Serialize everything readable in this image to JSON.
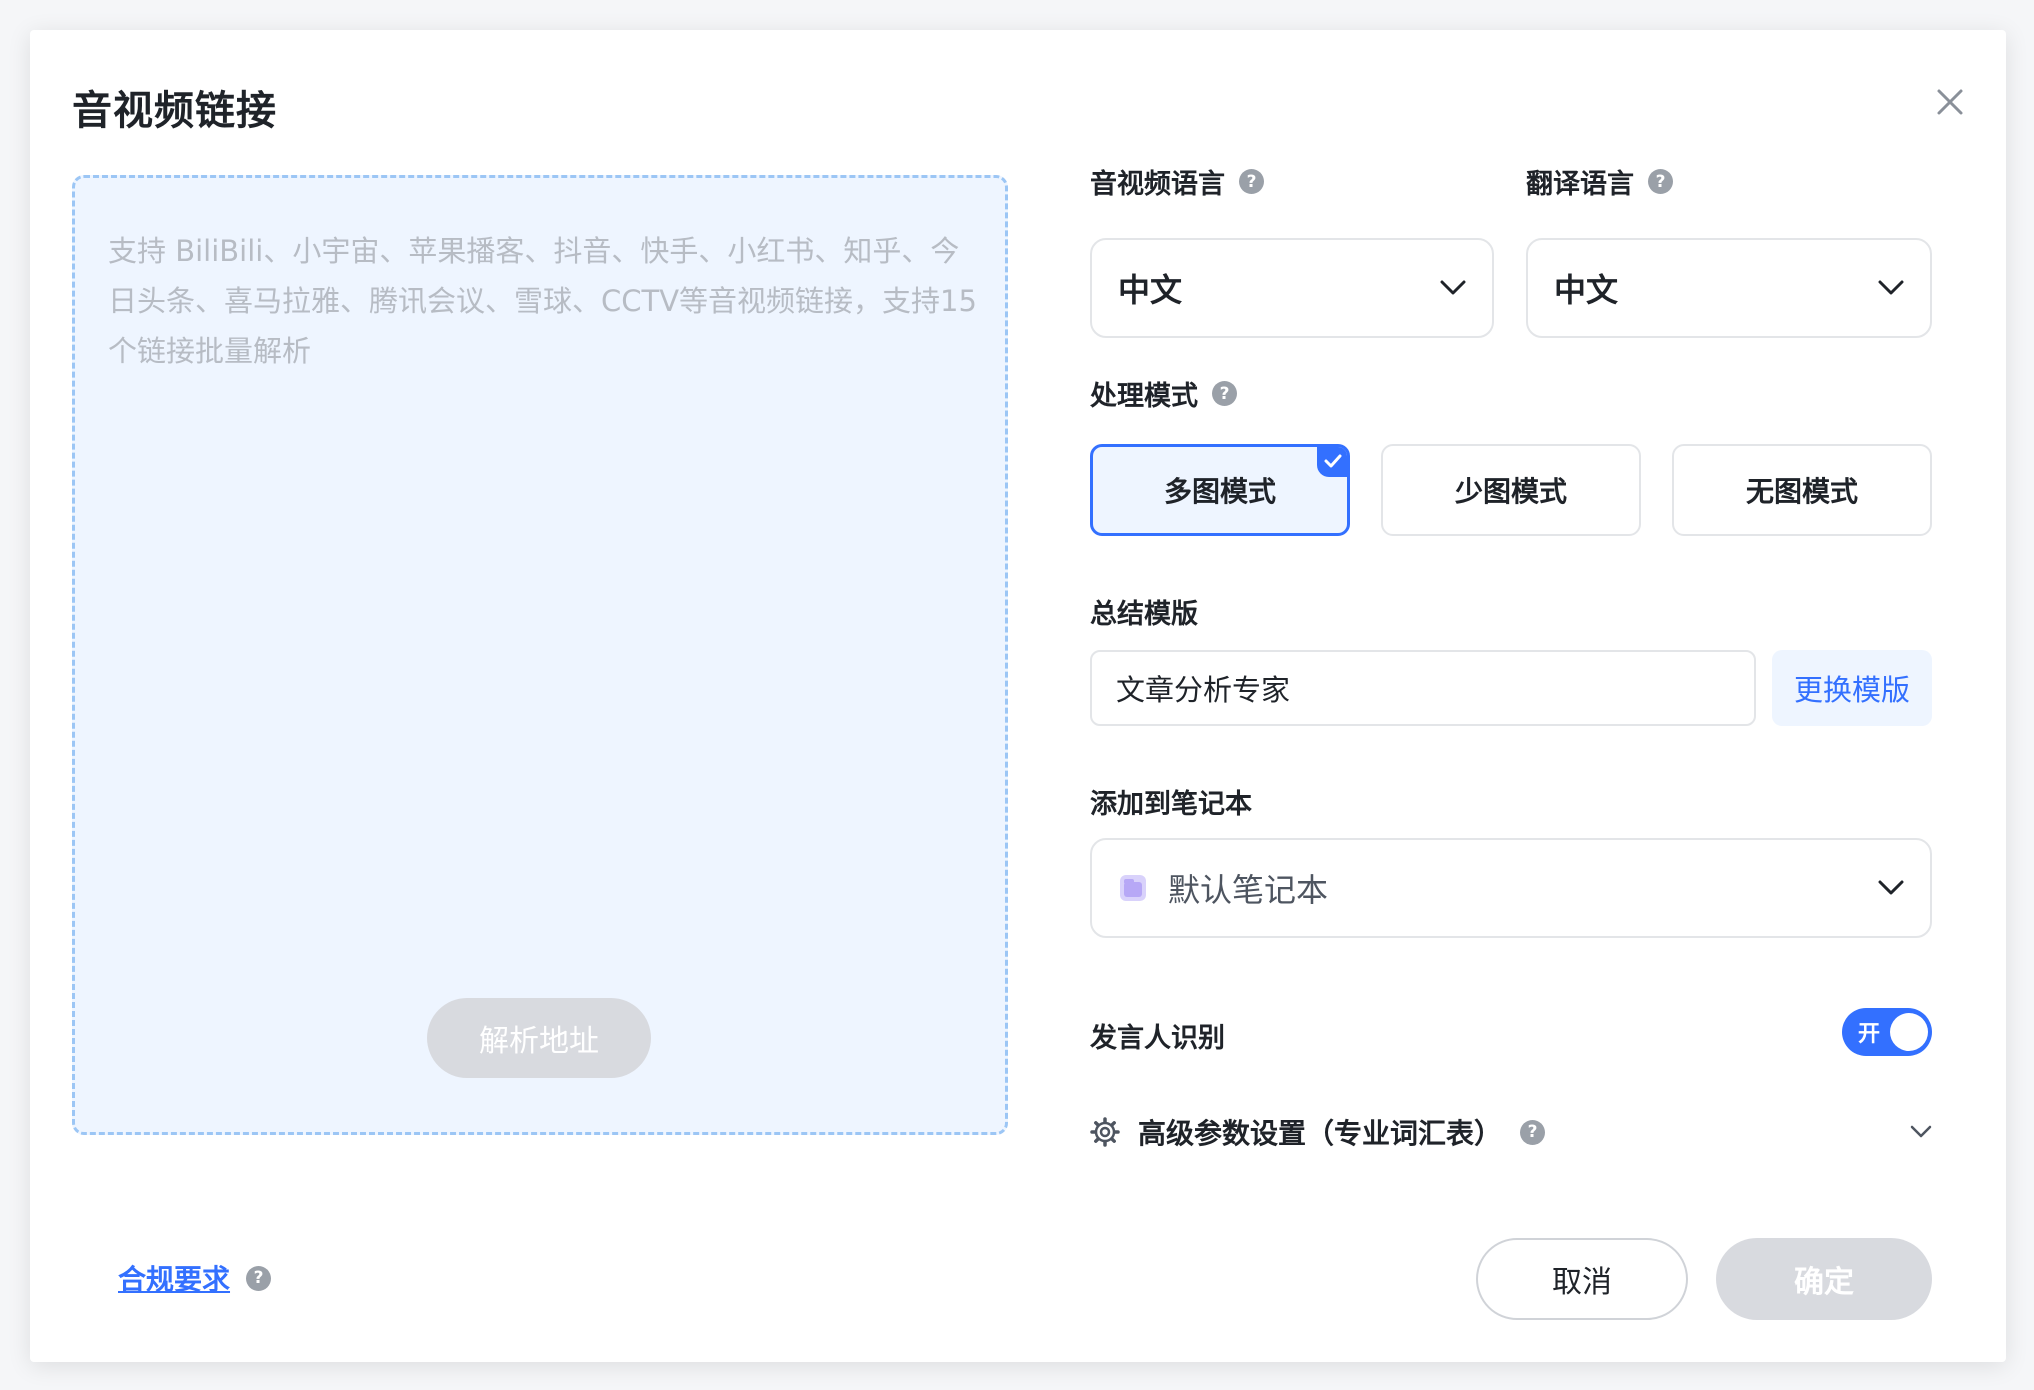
{
  "dialog": {
    "title": "音视频链接"
  },
  "link_area": {
    "placeholder": "支持 BiliBili、小宇宙、苹果播客、抖音、快手、小红书、知乎、今日头条、喜马拉雅、腾讯会议、雪球、CCTV等音视频链接，支持15个链接批量解析",
    "parse_button_label": "解析地址"
  },
  "audio_language": {
    "label": "音视频语言",
    "value": "中文"
  },
  "translate_language": {
    "label": "翻译语言",
    "value": "中文"
  },
  "processing_mode": {
    "label": "处理模式",
    "options": [
      "多图模式",
      "少图模式",
      "无图模式"
    ],
    "selected": "多图模式"
  },
  "summary_template": {
    "label": "总结模版",
    "value": "文章分析专家",
    "change_label": "更换模版"
  },
  "notebook": {
    "label": "添加到笔记本",
    "value": "默认笔记本"
  },
  "speaker_recognition": {
    "label": "发言人识别",
    "toggle_text": "开",
    "enabled": true
  },
  "advanced": {
    "label": "高级参数设置（专业词汇表）"
  },
  "footer": {
    "compliance_label": "合规要求",
    "cancel_label": "取消",
    "confirm_label": "确定"
  },
  "colors": {
    "accent": "#3370ff",
    "disabled_button": "#d8dadf",
    "link_area_bg": "#eef5ff",
    "link_area_border": "#9cc6f5"
  }
}
